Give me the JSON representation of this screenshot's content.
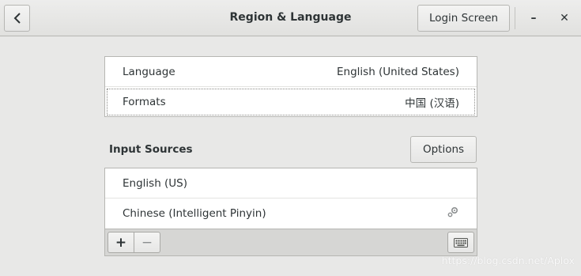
{
  "header": {
    "back_icon": "chevron-left-icon",
    "title": "Region & Language",
    "login_screen_label": "Login Screen",
    "minimize_glyph": "–",
    "close_glyph": "✕"
  },
  "region": {
    "rows": [
      {
        "label": "Language",
        "value": "English (United States)"
      },
      {
        "label": "Formats",
        "value": "中国 (汉语)"
      }
    ]
  },
  "input_sources": {
    "title": "Input Sources",
    "options_label": "Options",
    "items": [
      {
        "label": "English (US)"
      },
      {
        "label": "Chinese (Intelligent Pinyin)",
        "icon": "gear-icon"
      }
    ],
    "toolbar": {
      "add_glyph": "+",
      "remove_glyph": "−",
      "keyboard_icon": "keyboard-icon"
    }
  },
  "watermark": "https://blog.csdn.net/Aplox"
}
